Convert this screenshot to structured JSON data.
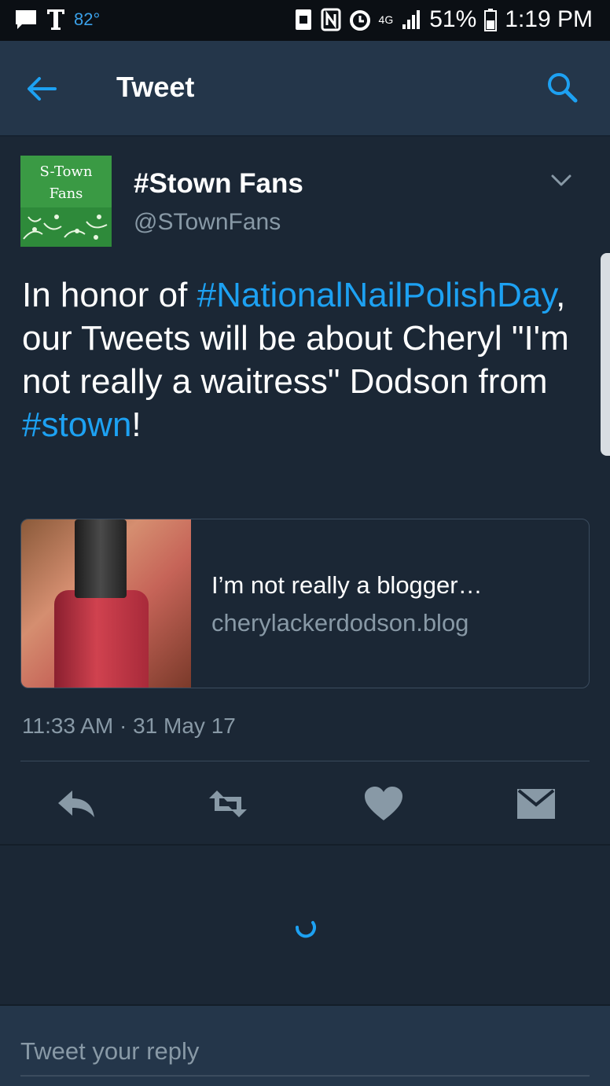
{
  "status_bar": {
    "temperature": "82°",
    "network": "4G",
    "battery": "51%",
    "time": "1:19 PM"
  },
  "header": {
    "title": "Tweet"
  },
  "tweet": {
    "avatar_text_line1": "S-Town",
    "avatar_text_line2": "Fans",
    "display_name": "#Stown Fans",
    "handle": "@STownFans",
    "text_segments": [
      {
        "text": "In honor of ",
        "hashtag": false
      },
      {
        "text": "#NationalNailPolishDay",
        "hashtag": true
      },
      {
        "text": ", our Tweets will be about Cheryl \"I'm not really a waitress\" Dodson from ",
        "hashtag": false
      },
      {
        "text": "#stown",
        "hashtag": true
      },
      {
        "text": "!",
        "hashtag": false
      }
    ],
    "card": {
      "title": "I’m not really a blogger…",
      "url": "cherylackerdodson.blog"
    },
    "timestamp": "11:33 AM · 31 May 17"
  },
  "reply": {
    "placeholder": "Tweet your reply"
  },
  "colors": {
    "background": "#1b2735",
    "bar": "#24364a",
    "accent": "#1da1f2",
    "muted": "#8899a6"
  },
  "icons": [
    "back-arrow-icon",
    "search-icon",
    "chevron-down-icon",
    "reply-icon",
    "retweet-icon",
    "heart-icon",
    "direct-message-icon",
    "loading-spinner-icon"
  ]
}
